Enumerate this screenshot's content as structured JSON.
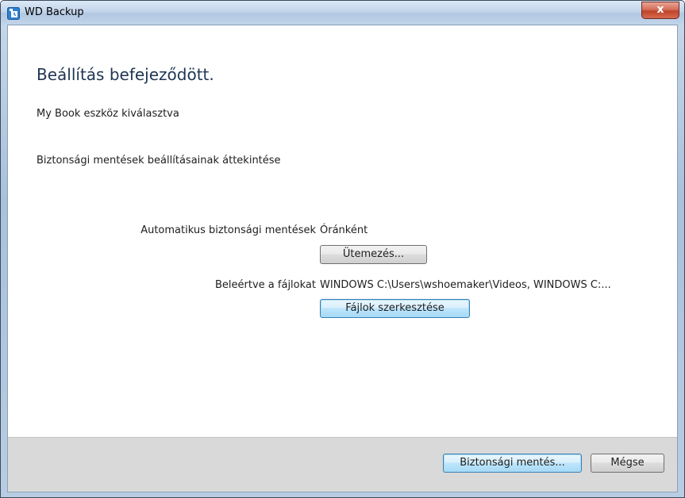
{
  "window": {
    "title": "WD Backup",
    "close_label": "x"
  },
  "page": {
    "heading": "Beállítás befejeződött.",
    "device_selected": "My Book eszköz kiválasztva",
    "review_label": "Biztonsági mentések beállításainak áttekintése"
  },
  "settings": {
    "auto_backup_label": "Automatikus biztonsági mentések",
    "auto_backup_value": "Óránként",
    "schedule_button": "Ütemezés...",
    "include_files_label": "Beleértve a fájlokat",
    "include_files_value": "WINDOWS C:\\Users\\wshoemaker\\Videos, WINDOWS C:...",
    "edit_files_button": "Fájlok szerkesztése"
  },
  "footer": {
    "backup_button": "Biztonsági mentés...",
    "cancel_button": "Mégse"
  },
  "icons": {
    "app": "wd-backup-app-icon"
  },
  "colors": {
    "heading": "#1f3553",
    "footer_bg": "#d9d9d9",
    "close_button": "#c0432a"
  }
}
